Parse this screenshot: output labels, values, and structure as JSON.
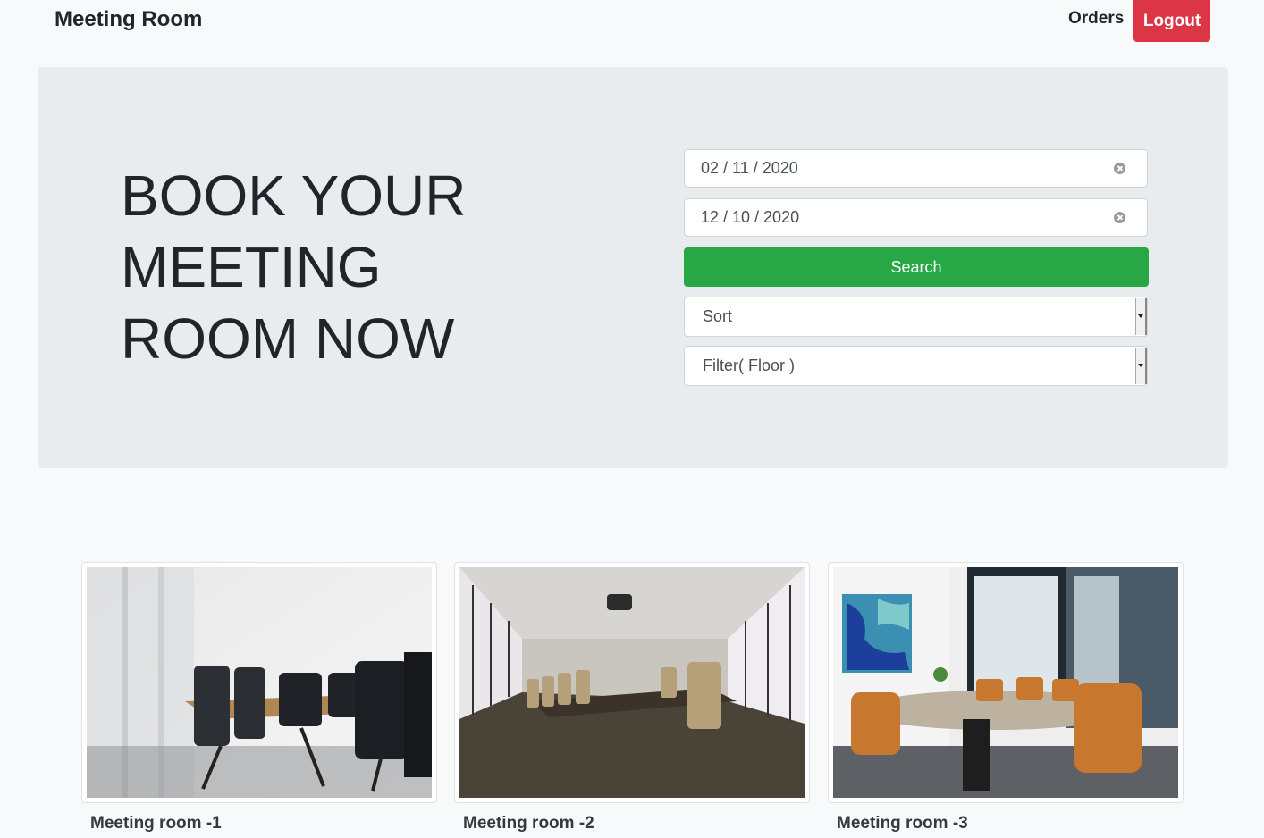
{
  "navbar": {
    "brand": "Meeting Room",
    "orders": "Orders",
    "logout": "Logout"
  },
  "hero": {
    "title": "BOOK YOUR MEETING ROOM NOW",
    "start_date": "02 / 11 / 2020",
    "end_date": "12 / 10 / 2020",
    "search_label": "Search",
    "sort_selected": "Sort",
    "filter_selected": "Filter( Floor )"
  },
  "rooms": [
    {
      "name": "Meeting room -1"
    },
    {
      "name": "Meeting room -2"
    },
    {
      "name": "Meeting room -3"
    }
  ],
  "colors": {
    "logout": "#dc3545",
    "search": "#28a745",
    "hero_bg": "#e9ecef"
  }
}
